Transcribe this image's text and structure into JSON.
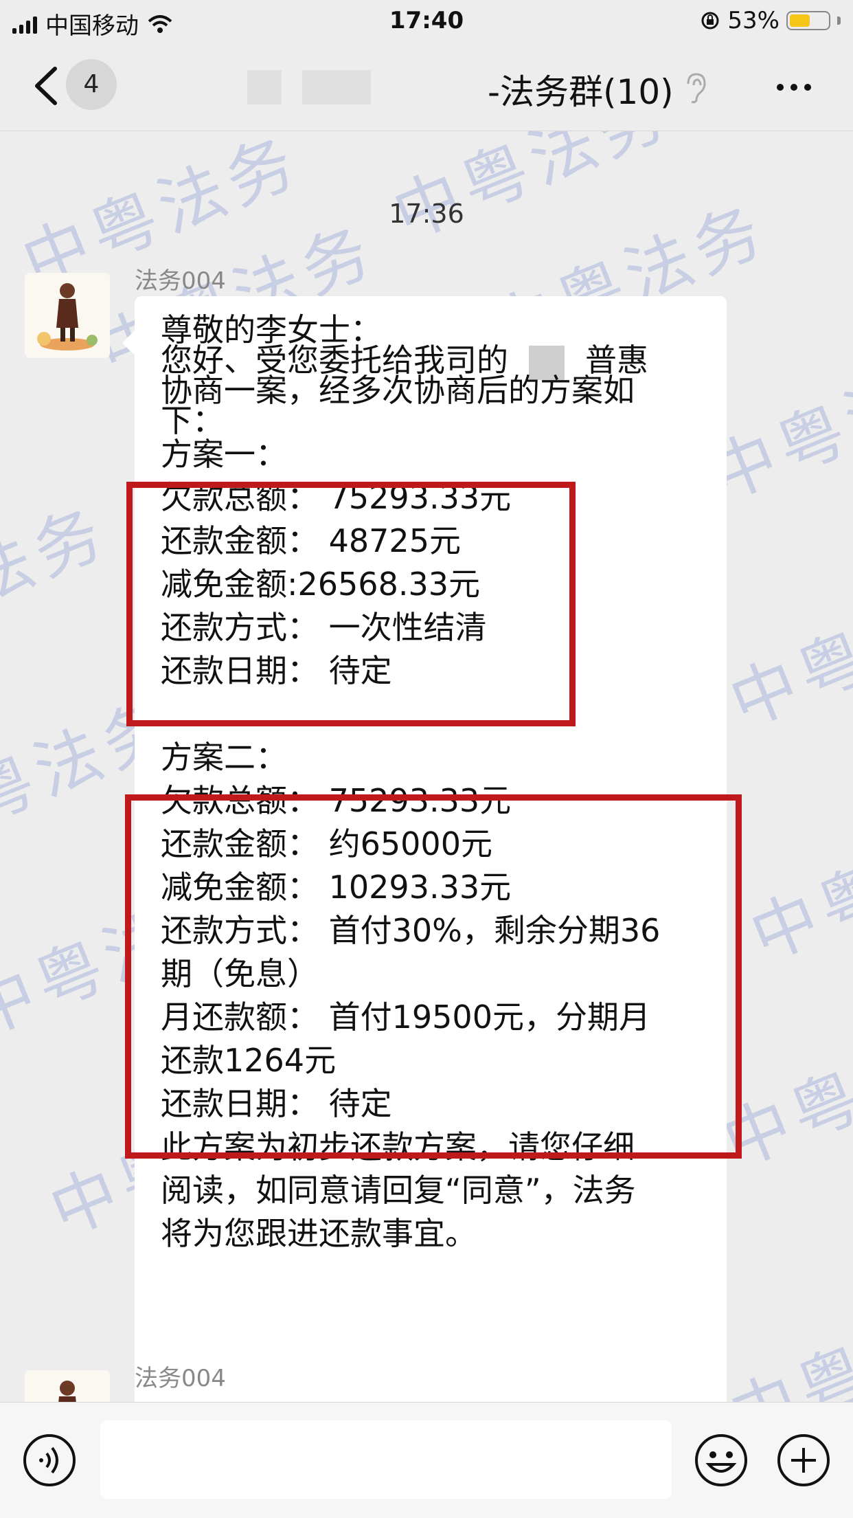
{
  "status_bar": {
    "carrier": "中国移动",
    "time": "17:40",
    "battery_percent": "53%",
    "battery_level": 0.53,
    "battery_color": "#f5c518"
  },
  "nav": {
    "unread_count": "4",
    "title": "-法务群(10)",
    "icons": [
      "chevron-left-icon",
      "ear-icon",
      "more-icon"
    ]
  },
  "chat": {
    "timestamp": "17:36",
    "watermark": "中粤法务",
    "messages": [
      {
        "sender": "法务004",
        "lines": {
          "greeting": "尊敬的李女士：",
          "intro_1_a": "您好、受您委托给我司的",
          "intro_1_b": "普惠",
          "intro_2": "协商一案，经多次协商后的方案如",
          "intro_3": "下：",
          "plan1_title": "方案一：",
          "plan1_total": "欠款总额：  75293.33元",
          "plan1_repay": "还款金额：  48725元",
          "plan1_waive": "减免金额:26568.33元",
          "plan1_method": "还款方式：  一次性结清",
          "plan1_date": "还款日期：  待定",
          "plan2_title": "方案二：",
          "plan2_total": "欠款总额：  75293.33元",
          "plan2_repay": "还款金额：  约65000元",
          "plan2_waive": "减免金额：  10293.33元",
          "plan2_method_1": "还款方式：  首付30%，剩余分期36",
          "plan2_method_2": "期（免息）",
          "plan2_monthly_1": "月还款额：  首付19500元，分期月",
          "plan2_monthly_2": "还款1264元",
          "plan2_date": "还款日期：  待定",
          "closing_1": "此方案为初步还款方案，请您仔细",
          "closing_2": "阅读，如同意请回复“同意”，法务",
          "closing_3": "将为您跟进还款事宜。"
        }
      },
      {
        "sender": "法务004"
      }
    ]
  },
  "highlight_color": "#c0191c",
  "input_bar": {
    "icons": [
      "voice-icon",
      "emoji-icon",
      "plus-icon"
    ]
  }
}
